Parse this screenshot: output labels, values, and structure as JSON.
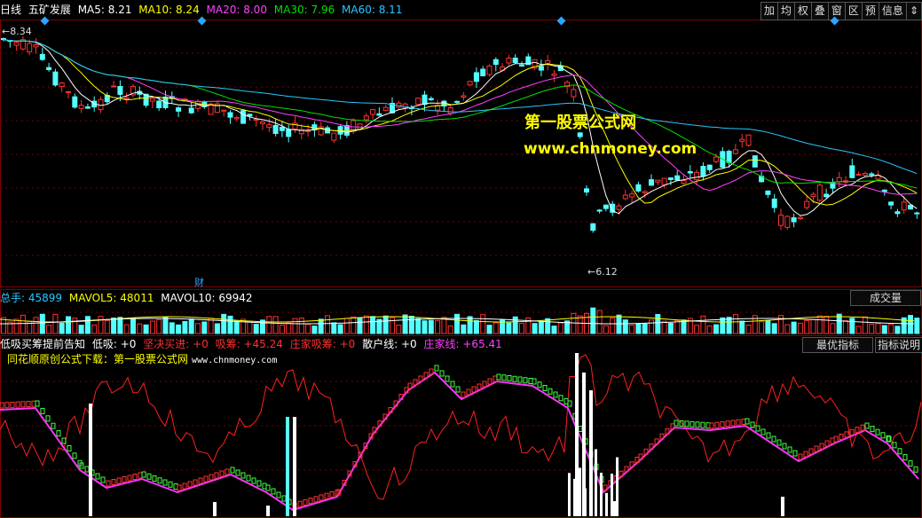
{
  "header": {
    "period": "日线",
    "stock_name": "五矿发展",
    "ma": [
      {
        "label": "MA5: 8.21",
        "color": "#ffffff"
      },
      {
        "label": "MA10: 8.24",
        "color": "#ffff00"
      },
      {
        "label": "MA20: 8.00",
        "color": "#ff40ff"
      },
      {
        "label": "MA30: 7.96",
        "color": "#00e000"
      },
      {
        "label": "MA60: 8.11",
        "color": "#29c6ff"
      }
    ]
  },
  "toolbar": [
    "加",
    "均",
    "权",
    "叠",
    "窗",
    "区",
    "预",
    "信息",
    "⇕"
  ],
  "price_panel": {
    "high_label": "8.34",
    "low_label": "6.12",
    "event_marker": "财",
    "watermark_cn": "第一股票公式网",
    "watermark_url": "www.chnmoney.com"
  },
  "volume_panel": {
    "items": [
      {
        "label": "总手: 45899",
        "color": "#29c6ff"
      },
      {
        "label": "MAVOL5: 48011",
        "color": "#ffff00"
      },
      {
        "label": "MAVOL10: 69942",
        "color": "#ffffff"
      }
    ],
    "button": "成交量"
  },
  "indicator_panel": {
    "items": [
      {
        "label": "低吸买筹提前告知",
        "color": "#ffffff"
      },
      {
        "label": "低吸: +0",
        "color": "#ffffff"
      },
      {
        "label": "坚决买进: +0",
        "color": "#ff3030"
      },
      {
        "label": "吸筹: +45.24",
        "color": "#ff3030"
      },
      {
        "label": "庄家吸筹: +0",
        "color": "#ff3030"
      },
      {
        "label": "散户线: +0",
        "color": "#ffffff"
      },
      {
        "label": "庄家线: +65.41",
        "color": "#ff40ff"
      }
    ],
    "subtitle_cn": "同花顺原创公式下载：第一股票公式网",
    "subtitle_url": "www.chnmoney.com",
    "buttons": [
      "最优指标",
      "指标说明"
    ]
  },
  "colors": {
    "up": "#ff3232",
    "down": "#54ffff",
    "grid": "#800000"
  }
}
